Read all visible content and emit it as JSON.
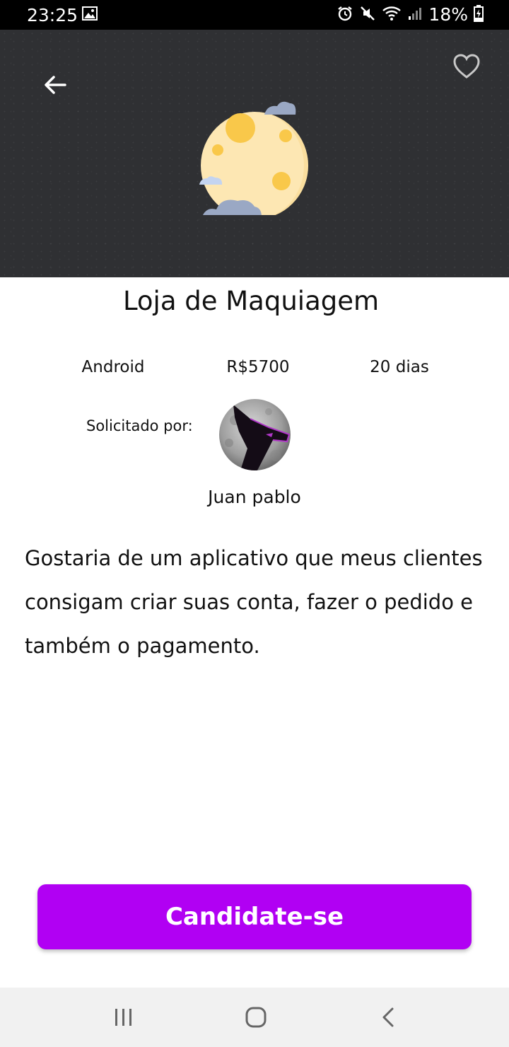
{
  "status_bar": {
    "time": "23:25",
    "battery": "18%",
    "icons": [
      "gallery-icon",
      "alarm-icon",
      "mute-icon",
      "wifi-icon",
      "signal-icon",
      "battery-charging-icon"
    ]
  },
  "header": {
    "back_icon": "arrow-left-icon",
    "favorite_icon": "heart-outline-icon",
    "illustration": "moon-with-clouds"
  },
  "project": {
    "title": "Loja de Maquiagem",
    "platform": "Android",
    "price": "R$5700",
    "duration": "20 dias",
    "requested_by_label": "Solicitado por:",
    "requester_name": "Juan pablo",
    "description": "Gostaria de um aplicativo que meus clientes consigam criar suas conta, fazer o pedido e também o pagamento."
  },
  "actions": {
    "apply_label": "Candidate-se"
  },
  "nav_bar": {
    "icons": [
      "recents-icon",
      "home-icon",
      "back-icon"
    ]
  },
  "colors": {
    "accent": "#b100f3",
    "header_bg": "#2f3033",
    "moon": "#fde7b3",
    "moon_spots": "#f9c84a",
    "clouds": "#9aa8c4"
  }
}
